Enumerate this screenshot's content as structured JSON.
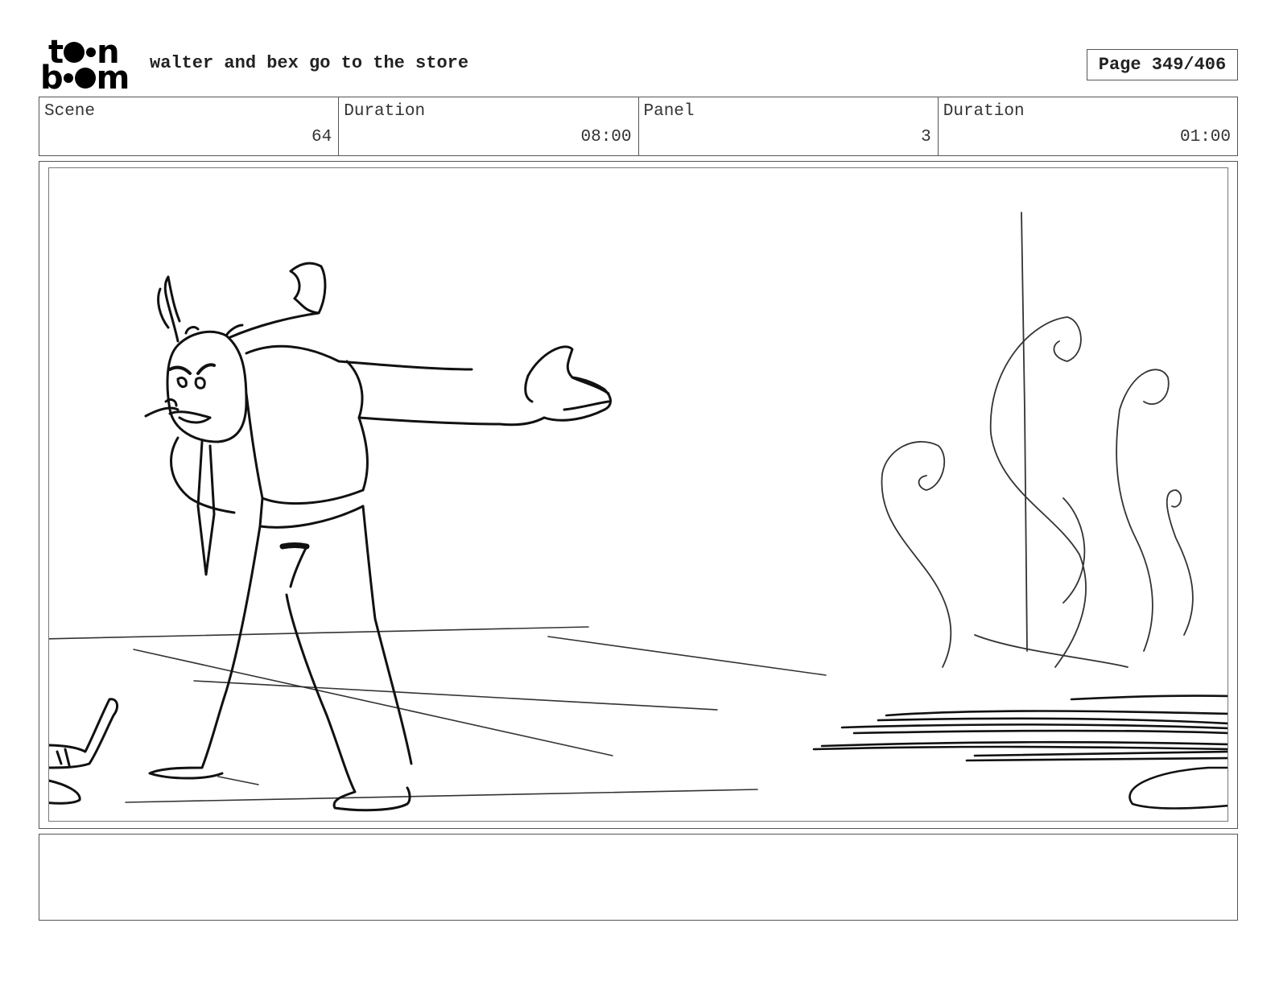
{
  "header": {
    "logo_text": "toon boom",
    "title": "walter and bex go to the store",
    "page_label": "Page 349/406"
  },
  "info": {
    "scene_label": "Scene",
    "scene_value": "64",
    "scene_duration_label": "Duration",
    "scene_duration_value": "08:00",
    "panel_label": "Panel",
    "panel_value": "3",
    "panel_duration_label": "Duration",
    "panel_duration_value": "01:00"
  },
  "notes": {
    "text": ""
  }
}
